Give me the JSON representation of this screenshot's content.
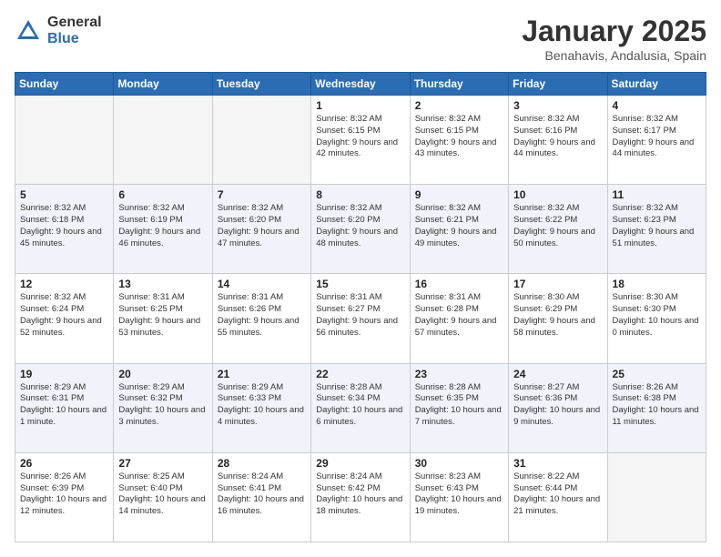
{
  "logo": {
    "general": "General",
    "blue": "Blue"
  },
  "title": "January 2025",
  "subtitle": "Benahavis, Andalusia, Spain",
  "days_of_week": [
    "Sunday",
    "Monday",
    "Tuesday",
    "Wednesday",
    "Thursday",
    "Friday",
    "Saturday"
  ],
  "weeks": [
    {
      "alt": false,
      "cells": [
        {
          "day": "",
          "empty": true
        },
        {
          "day": "",
          "empty": true
        },
        {
          "day": "",
          "empty": true
        },
        {
          "day": "1",
          "sunrise": "8:32 AM",
          "sunset": "6:15 PM",
          "daylight": "9 hours and 42 minutes."
        },
        {
          "day": "2",
          "sunrise": "8:32 AM",
          "sunset": "6:15 PM",
          "daylight": "9 hours and 43 minutes."
        },
        {
          "day": "3",
          "sunrise": "8:32 AM",
          "sunset": "6:16 PM",
          "daylight": "9 hours and 44 minutes."
        },
        {
          "day": "4",
          "sunrise": "8:32 AM",
          "sunset": "6:17 PM",
          "daylight": "9 hours and 44 minutes."
        }
      ]
    },
    {
      "alt": true,
      "cells": [
        {
          "day": "5",
          "sunrise": "8:32 AM",
          "sunset": "6:18 PM",
          "daylight": "9 hours and 45 minutes."
        },
        {
          "day": "6",
          "sunrise": "8:32 AM",
          "sunset": "6:19 PM",
          "daylight": "9 hours and 46 minutes."
        },
        {
          "day": "7",
          "sunrise": "8:32 AM",
          "sunset": "6:20 PM",
          "daylight": "9 hours and 47 minutes."
        },
        {
          "day": "8",
          "sunrise": "8:32 AM",
          "sunset": "6:20 PM",
          "daylight": "9 hours and 48 minutes."
        },
        {
          "day": "9",
          "sunrise": "8:32 AM",
          "sunset": "6:21 PM",
          "daylight": "9 hours and 49 minutes."
        },
        {
          "day": "10",
          "sunrise": "8:32 AM",
          "sunset": "6:22 PM",
          "daylight": "9 hours and 50 minutes."
        },
        {
          "day": "11",
          "sunrise": "8:32 AM",
          "sunset": "6:23 PM",
          "daylight": "9 hours and 51 minutes."
        }
      ]
    },
    {
      "alt": false,
      "cells": [
        {
          "day": "12",
          "sunrise": "8:32 AM",
          "sunset": "6:24 PM",
          "daylight": "9 hours and 52 minutes."
        },
        {
          "day": "13",
          "sunrise": "8:31 AM",
          "sunset": "6:25 PM",
          "daylight": "9 hours and 53 minutes."
        },
        {
          "day": "14",
          "sunrise": "8:31 AM",
          "sunset": "6:26 PM",
          "daylight": "9 hours and 55 minutes."
        },
        {
          "day": "15",
          "sunrise": "8:31 AM",
          "sunset": "6:27 PM",
          "daylight": "9 hours and 56 minutes."
        },
        {
          "day": "16",
          "sunrise": "8:31 AM",
          "sunset": "6:28 PM",
          "daylight": "9 hours and 57 minutes."
        },
        {
          "day": "17",
          "sunrise": "8:30 AM",
          "sunset": "6:29 PM",
          "daylight": "9 hours and 58 minutes."
        },
        {
          "day": "18",
          "sunrise": "8:30 AM",
          "sunset": "6:30 PM",
          "daylight": "10 hours and 0 minutes."
        }
      ]
    },
    {
      "alt": true,
      "cells": [
        {
          "day": "19",
          "sunrise": "8:29 AM",
          "sunset": "6:31 PM",
          "daylight": "10 hours and 1 minute."
        },
        {
          "day": "20",
          "sunrise": "8:29 AM",
          "sunset": "6:32 PM",
          "daylight": "10 hours and 3 minutes."
        },
        {
          "day": "21",
          "sunrise": "8:29 AM",
          "sunset": "6:33 PM",
          "daylight": "10 hours and 4 minutes."
        },
        {
          "day": "22",
          "sunrise": "8:28 AM",
          "sunset": "6:34 PM",
          "daylight": "10 hours and 6 minutes."
        },
        {
          "day": "23",
          "sunrise": "8:28 AM",
          "sunset": "6:35 PM",
          "daylight": "10 hours and 7 minutes."
        },
        {
          "day": "24",
          "sunrise": "8:27 AM",
          "sunset": "6:36 PM",
          "daylight": "10 hours and 9 minutes."
        },
        {
          "day": "25",
          "sunrise": "8:26 AM",
          "sunset": "6:38 PM",
          "daylight": "10 hours and 11 minutes."
        }
      ]
    },
    {
      "alt": false,
      "cells": [
        {
          "day": "26",
          "sunrise": "8:26 AM",
          "sunset": "6:39 PM",
          "daylight": "10 hours and 12 minutes."
        },
        {
          "day": "27",
          "sunrise": "8:25 AM",
          "sunset": "6:40 PM",
          "daylight": "10 hours and 14 minutes."
        },
        {
          "day": "28",
          "sunrise": "8:24 AM",
          "sunset": "6:41 PM",
          "daylight": "10 hours and 16 minutes."
        },
        {
          "day": "29",
          "sunrise": "8:24 AM",
          "sunset": "6:42 PM",
          "daylight": "10 hours and 18 minutes."
        },
        {
          "day": "30",
          "sunrise": "8:23 AM",
          "sunset": "6:43 PM",
          "daylight": "10 hours and 19 minutes."
        },
        {
          "day": "31",
          "sunrise": "8:22 AM",
          "sunset": "6:44 PM",
          "daylight": "10 hours and 21 minutes."
        },
        {
          "day": "",
          "empty": true
        }
      ]
    }
  ]
}
